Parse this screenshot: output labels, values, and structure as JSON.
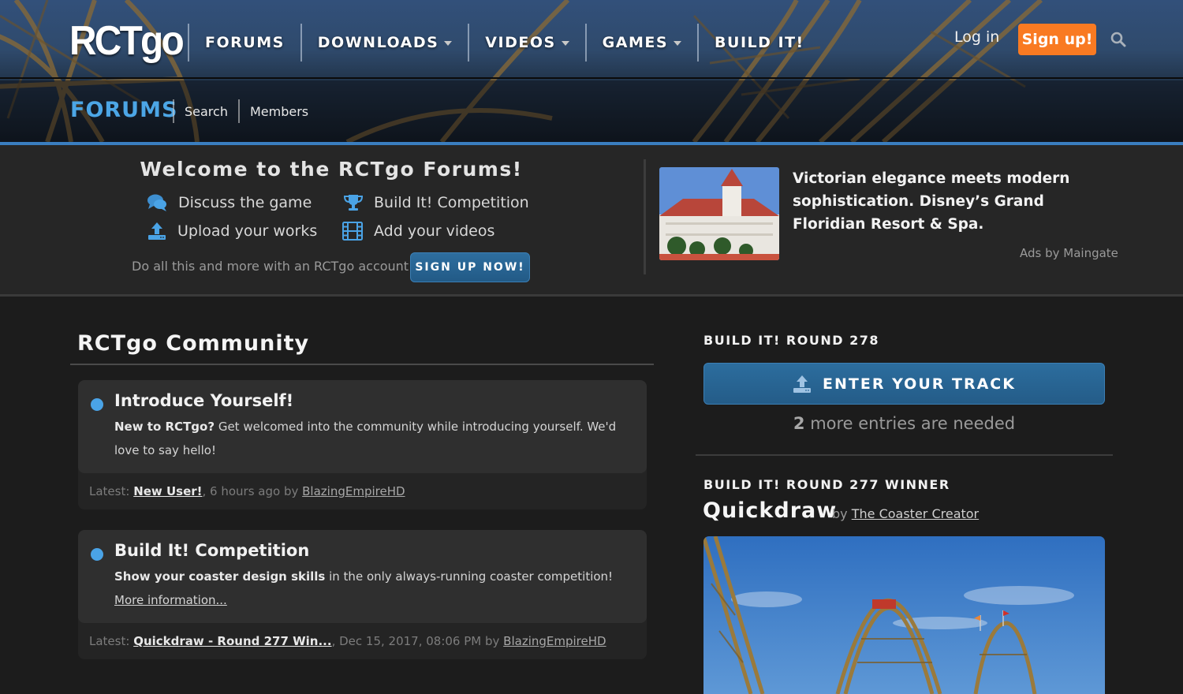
{
  "header": {
    "logo": "RCTgo",
    "nav": [
      {
        "label": "FORUMS",
        "dropdown": false
      },
      {
        "label": "DOWNLOADS",
        "dropdown": true
      },
      {
        "label": "VIDEOS",
        "dropdown": true
      },
      {
        "label": "GAMES",
        "dropdown": true
      },
      {
        "label": "BUILD IT!",
        "dropdown": false
      }
    ],
    "login_label": "Log in",
    "signup_label": "Sign up!",
    "search_icon": "search-icon",
    "section_title": "FORUMS",
    "subnav": [
      "Search",
      "Members"
    ],
    "accent_color": "#4ca6e6",
    "signup_color": "#f97a22"
  },
  "welcome": {
    "title": "Welcome to the RCTgo Forums!",
    "features": [
      {
        "icon": "chat-bubbles-icon",
        "label": "Discuss the game"
      },
      {
        "icon": "trophy-icon",
        "label": "Build It! Competition"
      },
      {
        "icon": "upload-icon",
        "label": "Upload your works"
      },
      {
        "icon": "film-icon",
        "label": "Add your videos"
      }
    ],
    "account_text": "Do all this and more with an RCTgo account:",
    "signup_now_label": "SIGN UP NOW!"
  },
  "ad": {
    "text": "Victorian elegance meets modern sophistication. Disney’s Grand Floridian Resort & Spa.",
    "attribution": "Ads by Maingate"
  },
  "community": {
    "title": "RCTgo Community",
    "forums": [
      {
        "name": "Introduce Yourself!",
        "desc_bold": "New to RCTgo?",
        "desc_rest": " Get welcomed into the community while introducing yourself. We'd love to say hello!",
        "desc_link": "",
        "latest_prefix": "Latest: ",
        "latest_post": "New User!",
        "latest_time": ", 6 hours ago by ",
        "latest_user": "BlazingEmpireHD"
      },
      {
        "name": "Build It! Competition",
        "desc_bold": "Show your coaster design skills",
        "desc_rest": " in the only always-running coaster competition! ",
        "desc_link": "More information...",
        "latest_prefix": "Latest: ",
        "latest_post": "Quickdraw - Round 277 Win...",
        "latest_time": ", Dec 15, 2017, 08:06 PM by ",
        "latest_user": "BlazingEmpireHD"
      }
    ]
  },
  "sidebar": {
    "round_heading": "BUILD IT! ROUND 278",
    "enter_label": "ENTER YOUR TRACK",
    "entries_count": "2",
    "entries_text": " more entries are needed",
    "winner_heading": "BUILD IT! ROUND 277 WINNER",
    "winner_name": "Quickdraw",
    "winner_by": "by ",
    "winner_author": "The Coaster Creator"
  }
}
